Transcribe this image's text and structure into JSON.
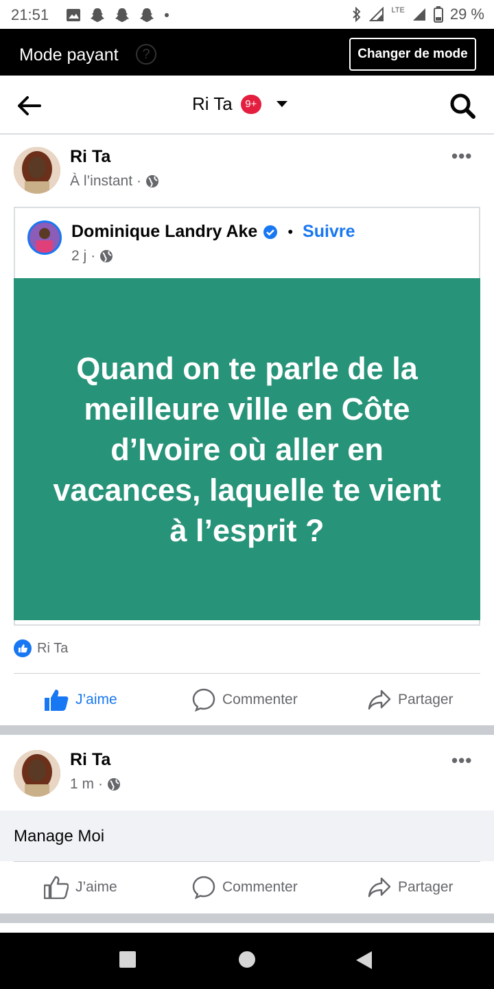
{
  "status_bar": {
    "time": "21:51",
    "network": "LTE",
    "battery": "29 %"
  },
  "mode_bar": {
    "label": "Mode payant",
    "help": "?",
    "switch_button": "Changer de mode"
  },
  "header": {
    "title": "Ri Ta",
    "badge": "9+"
  },
  "post1": {
    "author": "Ri Ta",
    "time": "À l’instant",
    "more": "•••",
    "shared": {
      "author": "Dominique Landry Ake",
      "separator": "•",
      "follow": "Suivre",
      "time": "2 j",
      "banner_text": "Quand on te parle de la meilleure ville en Côte d’Ivoire où aller en vacances, laquelle te vient à l’esprit ?"
    },
    "reaction_name": "Ri Ta",
    "actions": {
      "like": "J’aime",
      "comment": "Commenter",
      "share": "Partager"
    },
    "liked": true
  },
  "post2": {
    "author": "Ri Ta",
    "time": "1 m",
    "more": "•••",
    "text": "Manage Moi",
    "actions": {
      "like": "J’aime",
      "comment": "Commenter",
      "share": "Partager"
    },
    "liked": false
  },
  "colors": {
    "accent": "#1877f2",
    "banner": "#279379",
    "badge": "#e41e3f"
  }
}
